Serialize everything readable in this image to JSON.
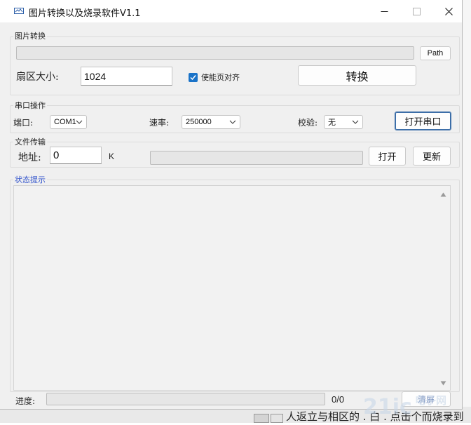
{
  "window": {
    "title": "图片转换以及烧录软件V1.1"
  },
  "image_convert": {
    "group_label": "图片转换",
    "path_button": "Path",
    "sector_label": "扇区大小:",
    "sector_value": "1024",
    "page_align_label": "使能页对齐",
    "page_align_checked": true,
    "convert_button": "转换"
  },
  "serial": {
    "group_label": "串口操作",
    "port_label": "端口:",
    "port_value": "COM1",
    "baud_label": "速率:",
    "baud_value": "250000",
    "parity_label": "校验:",
    "parity_value": "无",
    "open_button": "打开串口"
  },
  "file_transfer": {
    "group_label": "文件传输",
    "address_label": "地址:",
    "address_value": "0",
    "unit_label": "K",
    "open_button": "打开",
    "update_button": "更新"
  },
  "status": {
    "group_label": "状态提示",
    "label_color": "#3355cc"
  },
  "footer": {
    "progress_label": "进度:",
    "progress_text": "0/0",
    "progress_fraction": 0,
    "clear_button": "清屏"
  },
  "background": {
    "partial_text": "人返立与相区的 . 白 . 点击个而烧录到",
    "watermark": "电子网"
  }
}
